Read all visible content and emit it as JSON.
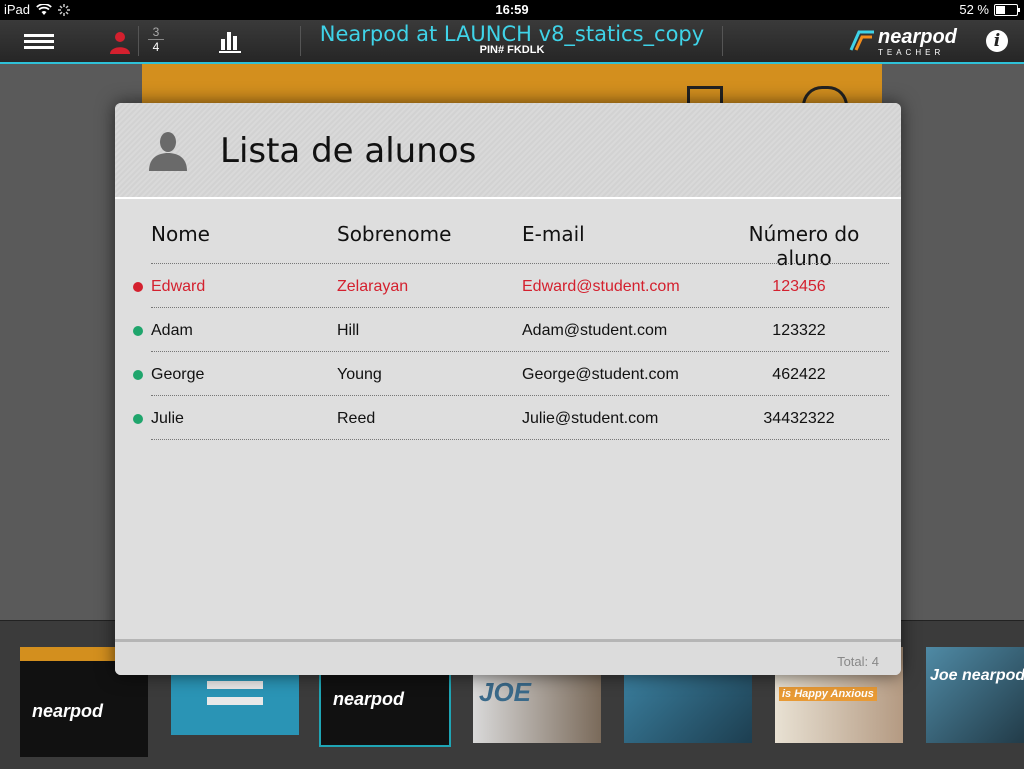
{
  "status": {
    "device": "iPad",
    "time": "16:59",
    "battery": "52 %",
    "battery_level": 0.52
  },
  "nav": {
    "count_top": "3",
    "count_bottom": "4",
    "title": "Nearpod at LAUNCH v8_statics_copy",
    "pin": "PIN# FKDLK",
    "brand": "nearpod",
    "brand_sub": "TEACHER",
    "accent": "#3fd3e8"
  },
  "modal": {
    "title": "Lista de alunos",
    "headers": {
      "name": "Nome",
      "surname": "Sobrenome",
      "email": "E-mail",
      "number": "Número do aluno"
    },
    "students": [
      {
        "name": "Edward",
        "surname": "Zelarayan",
        "email": "Edward@student.com",
        "number": "123456",
        "status": "offline"
      },
      {
        "name": "Adam",
        "surname": "Hill",
        "email": "Adam@student.com",
        "number": "123322",
        "status": "online"
      },
      {
        "name": "George",
        "surname": "Young",
        "email": "George@student.com",
        "number": "462422",
        "status": "online"
      },
      {
        "name": "Julie",
        "surname": "Reed",
        "email": "Julie@student.com",
        "number": "34432322",
        "status": "online"
      }
    ],
    "total": "Total: 4",
    "colors": {
      "online": "#1fa56c",
      "offline": "#d4202e"
    }
  },
  "filmstrip": {
    "slides": [
      {
        "label": "nearpod",
        "bg": "#111111"
      },
      {
        "label": "",
        "bg": "#2a94b5"
      },
      {
        "label": "nearpod",
        "bg": "#111111"
      },
      {
        "label": "JOE",
        "bg": "#cfcfcf"
      },
      {
        "label": "",
        "bg": "#2c6b8e"
      },
      {
        "label": "is Happy Anxious",
        "bg": "#e7e3da"
      },
      {
        "label": "Joe nearpod",
        "bg": "#2d5f78"
      }
    ]
  }
}
